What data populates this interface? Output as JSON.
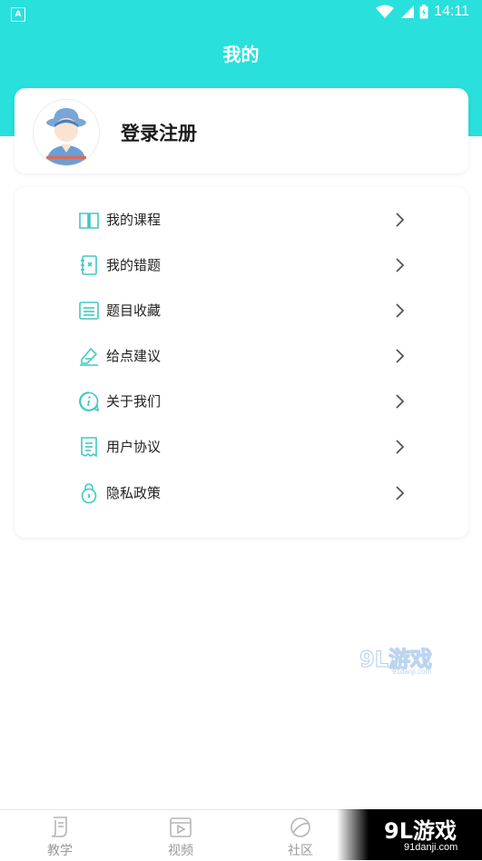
{
  "status_bar": {
    "badge": "A",
    "time": "14:11"
  },
  "header": {
    "title": "我的"
  },
  "profile": {
    "login_label": "登录注册",
    "avatar_icon": "user-avatar-icon"
  },
  "menu": {
    "items": [
      {
        "label": "我的课程",
        "icon": "book-icon"
      },
      {
        "label": "我的错题",
        "icon": "notebook-icon"
      },
      {
        "label": "题目收藏",
        "icon": "list-icon"
      },
      {
        "label": "给点建议",
        "icon": "feedback-icon"
      },
      {
        "label": "关于我们",
        "icon": "info-icon"
      },
      {
        "label": "用户协议",
        "icon": "document-icon"
      },
      {
        "label": "隐私政策",
        "icon": "lock-icon"
      }
    ]
  },
  "watermark": {
    "main": "9L游戏",
    "sub": "91danji.com"
  },
  "tabbar": {
    "tabs": [
      {
        "label": "教学",
        "icon": "teaching-icon"
      },
      {
        "label": "视频",
        "icon": "video-icon"
      },
      {
        "label": "社区",
        "icon": "community-icon"
      }
    ]
  },
  "corner_logo": {
    "main": "9L游戏",
    "sub": "91danji.com"
  },
  "colors": {
    "accent": "#29e0dc",
    "icon_teal": "#3fc9c3",
    "text": "#222222",
    "muted": "#999999"
  }
}
